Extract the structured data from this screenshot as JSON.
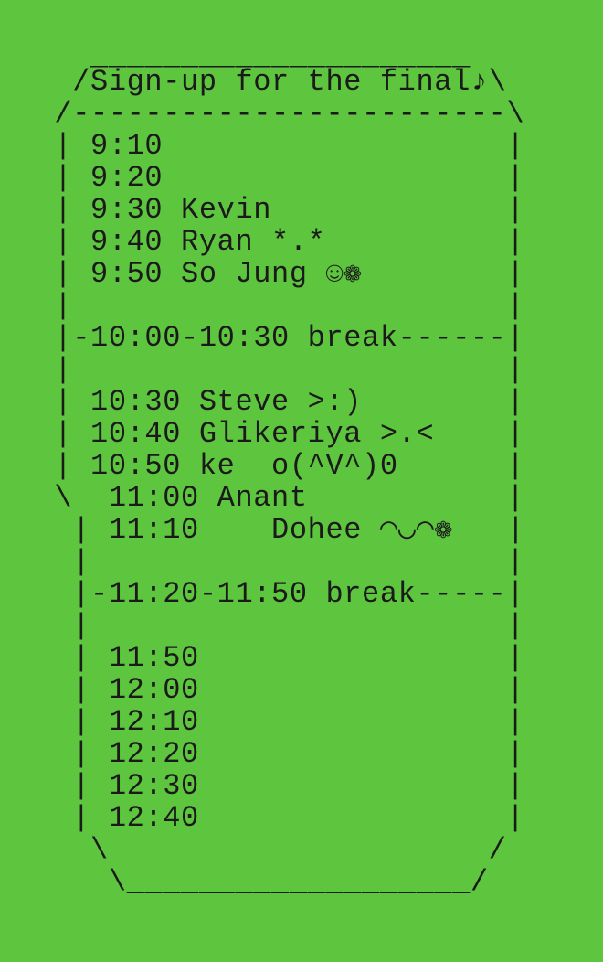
{
  "background_color": "#5ec53f",
  "text_color": "#1a1a1a",
  "title": "Sign-up for the final♪",
  "lines": [
    "     _____________________",
    "    /Sign-up for the final♪\\",
    "   /------------------------\\",
    "   | 9:10                   |",
    "   | 9:20                   |",
    "   | 9:30 Kevin             |",
    "   | 9:40 Ryan *.*          |",
    "   | 9:50 So Jung ☺❁        |",
    "   |                        |",
    "   |-10:00-10:30 break------|",
    "   |                        |",
    "   | 10:30 Steve >:)        |",
    "   | 10:40 Glikeriya >.<    |",
    "   | 10:50 ke  o(^V^)0      |",
    "   \\  11:00 Anant           |",
    "    | 11:10    Dohee ◠◡◠❁   |",
    "    |                       |",
    "    |-11:20-11:50 break-----|",
    "    |                       |",
    "    | 11:50                 |",
    "    | 12:00                 |",
    "    | 12:10                 |",
    "    | 12:20                 |",
    "    | 12:30                 |",
    "    | 12:40                 |",
    "     \\                     /",
    "      \\___________________/"
  ]
}
